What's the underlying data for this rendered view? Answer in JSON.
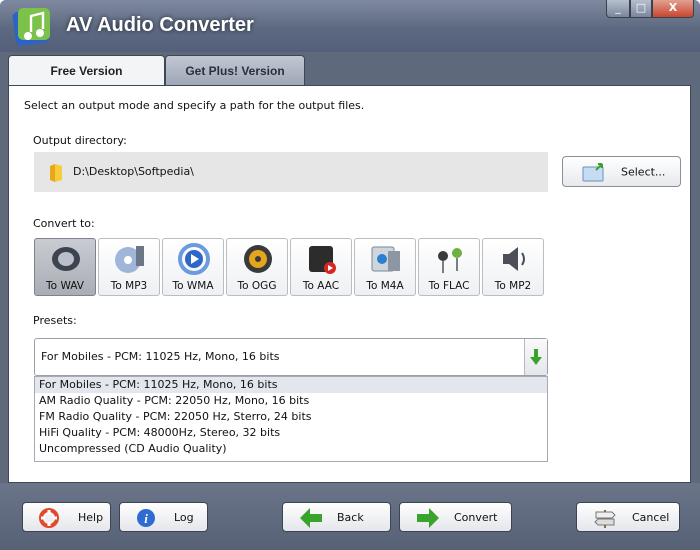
{
  "window": {
    "title": "AV Audio Converter",
    "controls": {
      "minimize": "_",
      "maximize": "□",
      "close": "X"
    }
  },
  "tabs": [
    {
      "label": "Free Version",
      "active": true
    },
    {
      "label": "Get Plus! Version",
      "active": false
    }
  ],
  "main": {
    "instruction": "Select an output mode and specify a path for the output files.",
    "output_directory": {
      "label": "Output directory:",
      "path": "D:\\Desktop\\Softpedia\\",
      "select_button": "Select..."
    },
    "convert": {
      "label": "Convert to:",
      "formats": [
        {
          "label": "To WAV",
          "icon": "speaker-icon",
          "selected": true
        },
        {
          "label": "To MP3",
          "icon": "cd-disc-icon",
          "selected": false
        },
        {
          "label": "To WMA",
          "icon": "wma-play-icon",
          "selected": false
        },
        {
          "label": "To OGG",
          "icon": "ogg-speaker-icon",
          "selected": false
        },
        {
          "label": "To AAC",
          "icon": "aac-device-icon",
          "selected": false
        },
        {
          "label": "To M4A",
          "icon": "m4a-film-icon",
          "selected": false
        },
        {
          "label": "To FLAC",
          "icon": "earphones-icon",
          "selected": false
        },
        {
          "label": "To MP2",
          "icon": "loudspeaker-icon",
          "selected": false
        }
      ]
    },
    "presets": {
      "label": "Presets:",
      "selected": "For Mobiles - PCM: 11025 Hz, Mono, 16 bits",
      "options": [
        "For Mobiles - PCM: 11025 Hz, Mono, 16 bits",
        "AM Radio Quality - PCM: 22050 Hz, Mono, 16 bits",
        "FM Radio Quality - PCM: 22050 Hz, Sterro, 24 bits",
        "HiFi Quality - PCM: 48000Hz, Stereo, 32 bits",
        "Uncompressed (CD Audio Quality)"
      ],
      "highlighted_index": 0
    }
  },
  "footer": {
    "help": "Help",
    "log": "Log",
    "back": "Back",
    "convert": "Convert",
    "cancel": "Cancel"
  },
  "colors": {
    "frame": "#5e6a7c",
    "panel": "#ffffff",
    "arrow_green": "#3aa32e",
    "close_red": "#c84530"
  }
}
